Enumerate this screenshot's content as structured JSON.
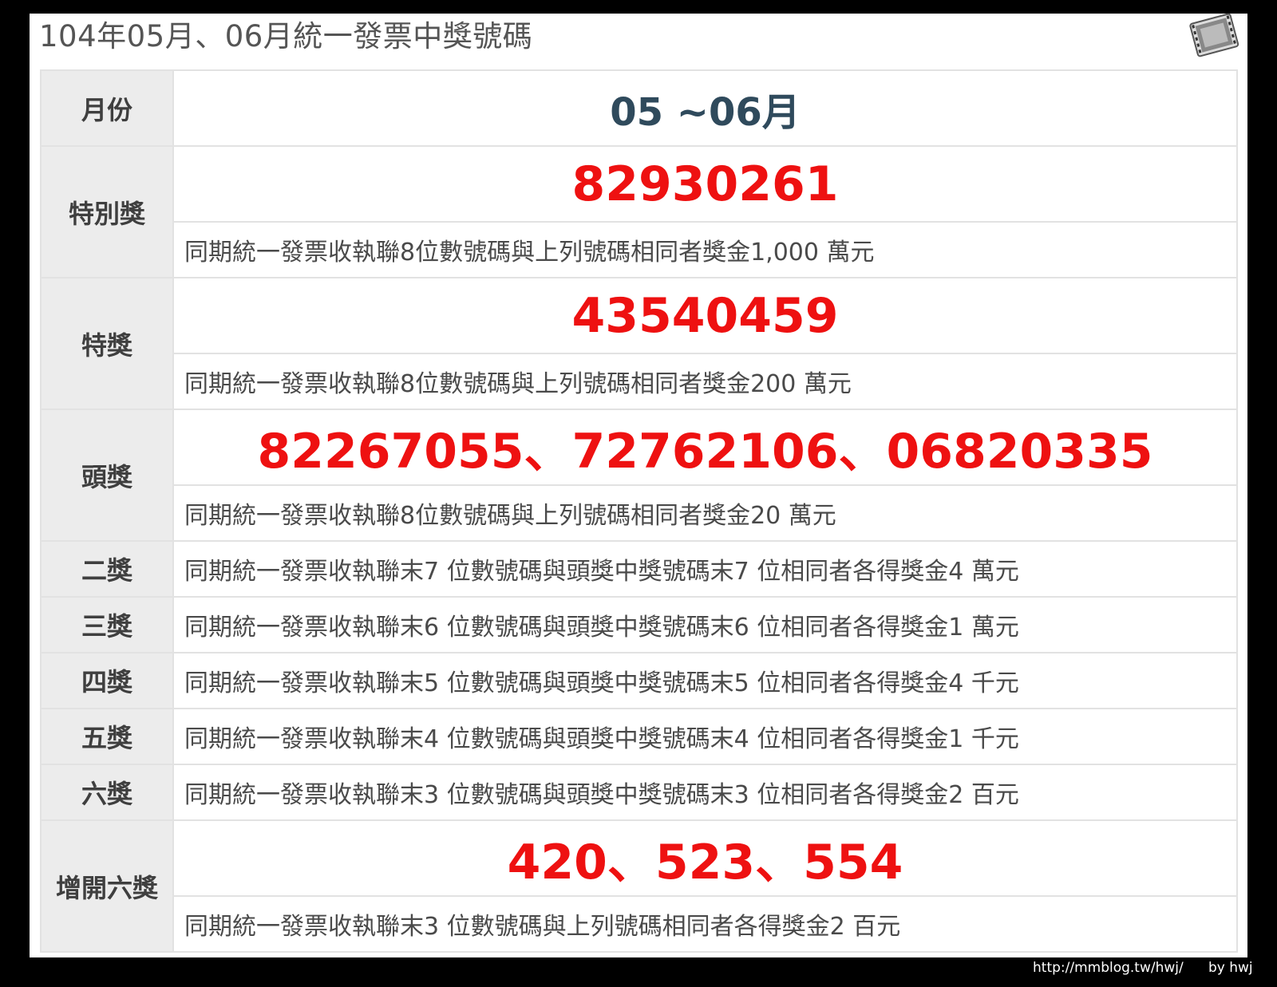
{
  "title": "104年05月、06月統一發票中獎號碼",
  "rows": {
    "month": {
      "label": "月份",
      "value": "05 ~06月"
    },
    "special": {
      "label": "特別獎",
      "number": "82930261",
      "desc": "同期統一發票收執聯8位數號碼與上列號碼相同者獎金1,000 萬元"
    },
    "grand": {
      "label": "特獎",
      "number": "43540459",
      "desc": "同期統一發票收執聯8位數號碼與上列號碼相同者獎金200 萬元"
    },
    "first": {
      "label": "頭獎",
      "number": "82267055、72762106、06820335",
      "desc": "同期統一發票收執聯8位數號碼與上列號碼相同者獎金20 萬元"
    },
    "second": {
      "label": "二獎",
      "desc": "同期統一發票收執聯末7 位數號碼與頭獎中獎號碼末7 位相同者各得獎金4 萬元"
    },
    "third": {
      "label": "三獎",
      "desc": "同期統一發票收執聯末6 位數號碼與頭獎中獎號碼末6 位相同者各得獎金1 萬元"
    },
    "fourth": {
      "label": "四獎",
      "desc": "同期統一發票收執聯末5 位數號碼與頭獎中獎號碼末5 位相同者各得獎金4 千元"
    },
    "fifth": {
      "label": "五獎",
      "desc": "同期統一發票收執聯末4 位數號碼與頭獎中獎號碼末4 位相同者各得獎金1 千元"
    },
    "sixth": {
      "label": "六獎",
      "desc": "同期統一發票收執聯末3 位數號碼與頭獎中獎號碼末3 位相同者各得獎金2 百元"
    },
    "extra_sixth": {
      "label": "增開六獎",
      "number": "420、523、554",
      "desc": "同期統一發票收執聯末3 位數號碼與上列號碼相同者各得獎金2 百元"
    }
  },
  "colors": {
    "winning_number": "#ee1111",
    "month_text": "#2f4a5c",
    "label_bg": "#ececec",
    "border": "#e2e2e2"
  },
  "watermark_icon": "film-strip-icon",
  "footer": {
    "url": "http://mmblog.tw/hwj/",
    "by": "by hwj"
  }
}
